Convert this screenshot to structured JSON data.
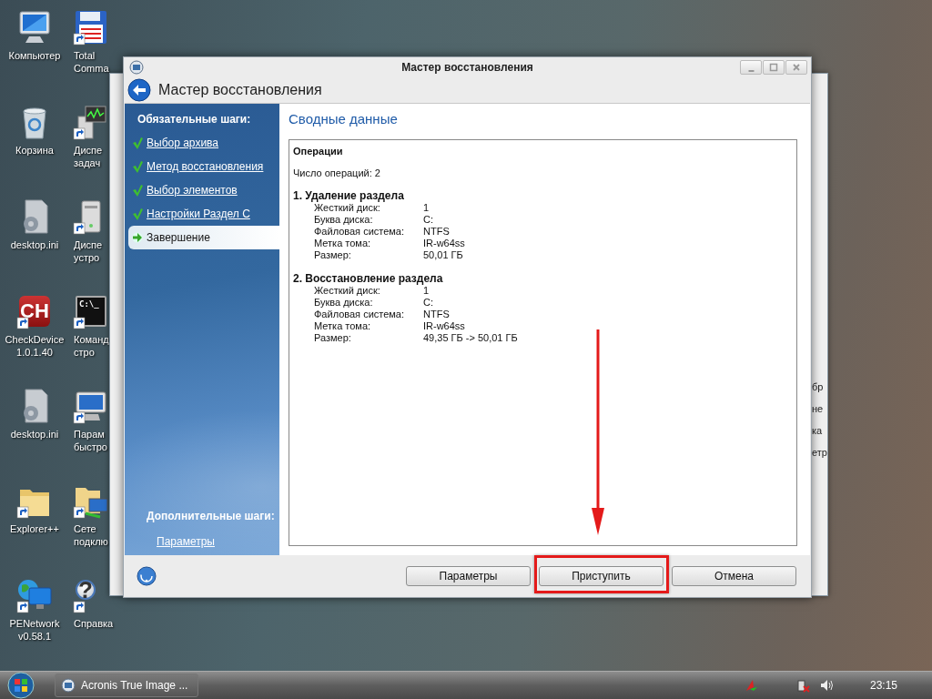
{
  "desktop_icons": [
    {
      "label": [
        "Компьютер"
      ],
      "shortcut": false
    },
    {
      "label": [
        "Корзина"
      ],
      "shortcut": false
    },
    {
      "label": [
        "desktop.ini"
      ],
      "shortcut": false
    },
    {
      "label": [
        "CheckDevice",
        "1.0.1.40"
      ],
      "shortcut": true,
      "badge": "CH"
    },
    {
      "label": [
        "desktop.ini"
      ],
      "shortcut": false
    },
    {
      "label": [
        "Explorer++"
      ],
      "shortcut": true
    },
    {
      "label": [
        "PENetwork",
        "v0.58.1"
      ],
      "shortcut": true
    },
    {
      "label": [
        "Total",
        "Comma"
      ],
      "shortcut": true
    },
    {
      "label": [
        "Диспе",
        "задач"
      ],
      "shortcut": true
    },
    {
      "label": [
        "Диспе",
        "устро"
      ],
      "shortcut": true
    },
    {
      "label": [
        "Команд",
        "стро"
      ],
      "shortcut": true,
      "badge": "C:\\_"
    },
    {
      "label": [
        "Парам",
        "быстро"
      ],
      "shortcut": true
    },
    {
      "label": [
        "Сете",
        "подклю"
      ],
      "shortcut": true
    },
    {
      "label": [
        "Справка"
      ],
      "shortcut": true,
      "badge": "?"
    }
  ],
  "background_window": {
    "text_fragments": [
      "бр",
      "не",
      "ка",
      "етр"
    ]
  },
  "window": {
    "title": "Мастер восстановления",
    "header": "Мастер восстановления",
    "sidebar": {
      "required_heading": "Обязательные шаги:",
      "steps": [
        {
          "label": "Выбор архива",
          "kind": "done"
        },
        {
          "label": "Метод восстановления",
          "kind": "done"
        },
        {
          "label": "Выбор элементов",
          "kind": "done"
        },
        {
          "label": "Настройки Раздел C",
          "kind": "done"
        },
        {
          "label": "Завершение",
          "kind": "current"
        }
      ],
      "optional_heading": "Дополнительные шаги:",
      "optional_links": [
        "Параметры"
      ]
    },
    "content": {
      "heading": "Сводные данные",
      "summary_title": "Операции",
      "count": "Число операций: 2",
      "operations": [
        {
          "title": "1. Удаление раздела",
          "fields": [
            {
              "label": "Жесткий диск:",
              "value": "1"
            },
            {
              "label": "Буква диска:",
              "value": "C:"
            },
            {
              "label": "Файловая система:",
              "value": "NTFS"
            },
            {
              "label": "Метка тома:",
              "value": "IR-w64ss"
            },
            {
              "label": "Размер:",
              "value": "50,01 ГБ"
            }
          ]
        },
        {
          "title": "2. Восстановление раздела",
          "fields": [
            {
              "label": "Жесткий диск:",
              "value": "1"
            },
            {
              "label": "Буква диска:",
              "value": "C:"
            },
            {
              "label": "Файловая система:",
              "value": "NTFS"
            },
            {
              "label": "Метка тома:",
              "value": "IR-w64ss"
            },
            {
              "label": "Размер:",
              "value": "49,35 ГБ -> 50,01 ГБ"
            }
          ]
        }
      ]
    },
    "buttons": [
      {
        "label": "Параметры",
        "annotated": false
      },
      {
        "label": "Приступить",
        "annotated": true
      },
      {
        "label": "Отмена",
        "annotated": false
      }
    ]
  },
  "taskbar": {
    "tasks": [
      "Acronis True Image ..."
    ],
    "clock": "23:15"
  }
}
